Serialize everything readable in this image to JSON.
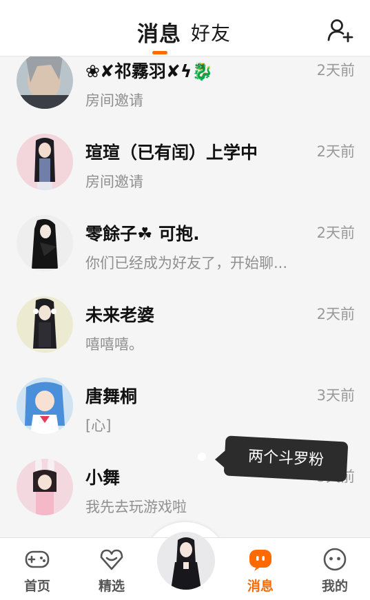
{
  "header": {
    "tab_messages": "消息",
    "tab_friends": "好友",
    "add_friend_icon": "add-user-icon",
    "accent_color": "#ff6a00"
  },
  "conversations": [
    {
      "name": "❀✘祁霧羽✘ϟ🐉",
      "message": "房间邀请",
      "time": "2天前"
    },
    {
      "name": "瑄瑄（已有闰）上学中",
      "message": "房间邀请",
      "time": "2天前"
    },
    {
      "name": "零餘子☘ 可抱.",
      "message": "你们已经成为好友了，开始聊...",
      "time": "2天前"
    },
    {
      "name": "未来老婆",
      "message": "嘻嘻嘻。",
      "time": "2天前"
    },
    {
      "name": "唐舞桐",
      "message": "[心]",
      "time": "3天前"
    },
    {
      "name": "小舞",
      "message": "我先去玩游戏啦",
      "time": "3天前"
    }
  ],
  "tooltip": {
    "text": "两个斗罗粉"
  },
  "bottom_nav": {
    "items": [
      {
        "label": "首页",
        "icon": "gamepad-icon"
      },
      {
        "label": "精选",
        "icon": "heart-gem-icon"
      },
      {
        "label": "消息",
        "icon": "chat-bubble-icon"
      },
      {
        "label": "我的",
        "icon": "smiley-face-icon"
      }
    ],
    "center_avatar": "profile-avatar"
  }
}
